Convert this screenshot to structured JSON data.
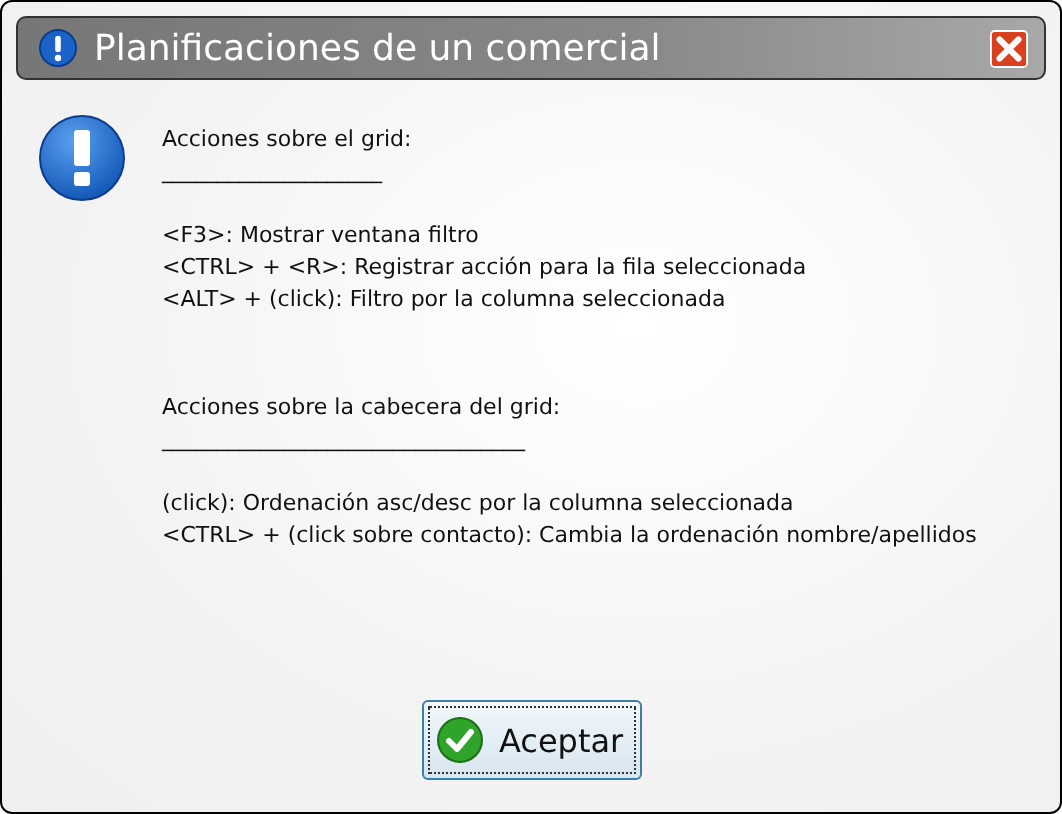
{
  "window": {
    "title": "Planificaciones de un comercial"
  },
  "sections": [
    {
      "heading": "Acciones sobre el grid:",
      "rule": "____________________",
      "lines": [
        "<F3>: Mostrar ventana filtro",
        "<CTRL> + <R>: Registrar acción para la fila seleccionada",
        "<ALT> + (click): Filtro por la columna seleccionada"
      ]
    },
    {
      "heading": "Acciones sobre la cabecera del grid:",
      "rule": "_________________________________",
      "lines": [
        "(click): Ordenación asc/desc por la columna seleccionada",
        "<CTRL> + (click sobre contacto): Cambia la ordenación nombre/apellidos"
      ]
    }
  ],
  "buttons": [
    {
      "label": "Aceptar"
    }
  ]
}
